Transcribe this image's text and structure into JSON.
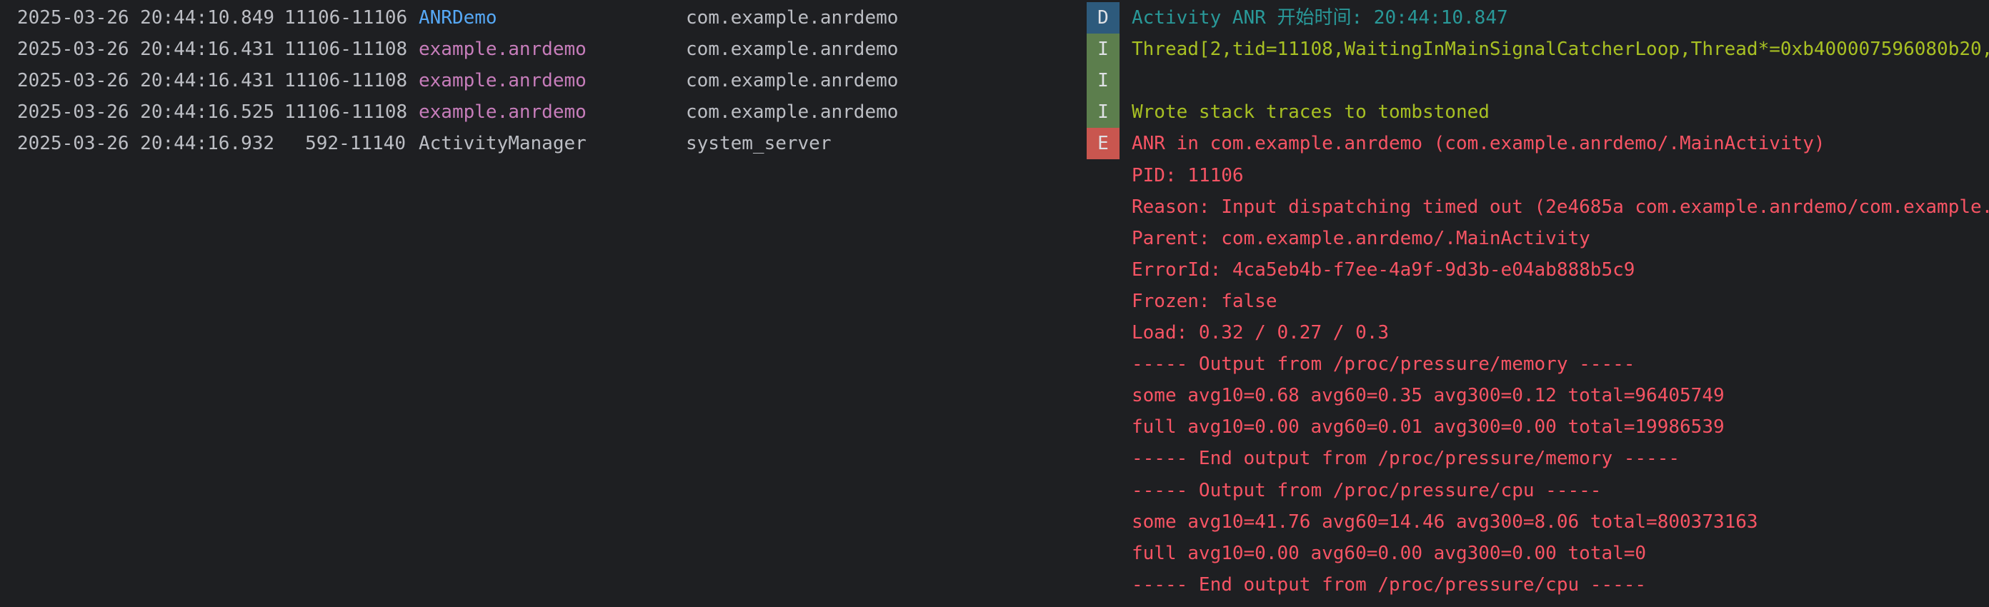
{
  "colors": {
    "background": "#1e1f22",
    "text_default": "#bcbec4",
    "tag_blue": "#56a8f5",
    "tag_purple": "#c77dbb",
    "msg_debug": "#299999",
    "msg_info": "#a8c023",
    "msg_error": "#f75464",
    "level_debug_bg": "#2d5a7c",
    "level_info_bg": "#5c7e4d",
    "level_error_bg": "#c9564f"
  },
  "rows": [
    {
      "timestamp": "2025-03-26 20:44:10.849",
      "pid": "11106-11106",
      "tag": "ANRDemo",
      "package": "com.example.anrdemo",
      "level": "D",
      "message": "Activity ANR 开始时间: 20:44:10.847"
    },
    {
      "timestamp": "2025-03-26 20:44:16.431",
      "pid": "11106-11108",
      "tag": "example.anrdemo",
      "package": "com.example.anrdemo",
      "level": "I",
      "message": "Thread[2,tid=11108,WaitingInMainSignalCatcherLoop,Thread*=0xb400007596080b20,"
    },
    {
      "timestamp": "2025-03-26 20:44:16.431",
      "pid": "11106-11108",
      "tag": "example.anrdemo",
      "package": "com.example.anrdemo",
      "level": "I",
      "message": ""
    },
    {
      "timestamp": "2025-03-26 20:44:16.525",
      "pid": "11106-11108",
      "tag": "example.anrdemo",
      "package": "com.example.anrdemo",
      "level": "I",
      "message": "Wrote stack traces to tombstoned"
    },
    {
      "timestamp": "2025-03-26 20:44:16.932",
      "pid": "592-11140",
      "tag": "ActivityManager",
      "package": "system_server",
      "level": "E",
      "message": "ANR in com.example.anrdemo (com.example.anrdemo/.MainActivity)"
    },
    {
      "timestamp": "",
      "pid": "",
      "tag": "",
      "package": "",
      "level": "",
      "message": "PID: 11106"
    },
    {
      "timestamp": "",
      "pid": "",
      "tag": "",
      "package": "",
      "level": "",
      "message": "Reason: Input dispatching timed out (2e4685a com.example.anrdemo/com.example."
    },
    {
      "timestamp": "",
      "pid": "",
      "tag": "",
      "package": "",
      "level": "",
      "message": "Parent: com.example.anrdemo/.MainActivity"
    },
    {
      "timestamp": "",
      "pid": "",
      "tag": "",
      "package": "",
      "level": "",
      "message": "ErrorId: 4ca5eb4b-f7ee-4a9f-9d3b-e04ab888b5c9"
    },
    {
      "timestamp": "",
      "pid": "",
      "tag": "",
      "package": "",
      "level": "",
      "message": "Frozen: false"
    },
    {
      "timestamp": "",
      "pid": "",
      "tag": "",
      "package": "",
      "level": "",
      "message": "Load: 0.32 / 0.27 / 0.3"
    },
    {
      "timestamp": "",
      "pid": "",
      "tag": "",
      "package": "",
      "level": "",
      "message": "----- Output from /proc/pressure/memory -----"
    },
    {
      "timestamp": "",
      "pid": "",
      "tag": "",
      "package": "",
      "level": "",
      "message": "some avg10=0.68 avg60=0.35 avg300=0.12 total=96405749"
    },
    {
      "timestamp": "",
      "pid": "",
      "tag": "",
      "package": "",
      "level": "",
      "message": "full avg10=0.00 avg60=0.01 avg300=0.00 total=19986539"
    },
    {
      "timestamp": "",
      "pid": "",
      "tag": "",
      "package": "",
      "level": "",
      "message": "----- End output from /proc/pressure/memory -----"
    },
    {
      "timestamp": "",
      "pid": "",
      "tag": "",
      "package": "",
      "level": "",
      "message": "----- Output from /proc/pressure/cpu -----"
    },
    {
      "timestamp": "",
      "pid": "",
      "tag": "",
      "package": "",
      "level": "",
      "message": "some avg10=41.76 avg60=14.46 avg300=8.06 total=800373163"
    },
    {
      "timestamp": "",
      "pid": "",
      "tag": "",
      "package": "",
      "level": "",
      "message": "full avg10=0.00 avg60=0.00 avg300=0.00 total=0"
    },
    {
      "timestamp": "",
      "pid": "",
      "tag": "",
      "package": "",
      "level": "",
      "message": "----- End output from /proc/pressure/cpu -----"
    }
  ]
}
